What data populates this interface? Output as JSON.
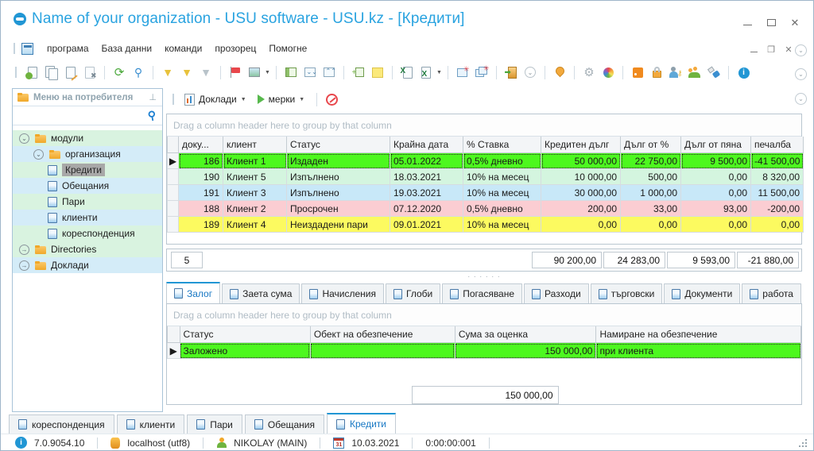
{
  "window": {
    "title": "Name of your organization - USU software - USU.kz - [Кредити]",
    "logo_icon": "usu-logo-icon",
    "minimize_label": "−",
    "maximize_label": "□",
    "close_label": "✕",
    "mdi_minimize_label": "−",
    "mdi_restore_label": "❐",
    "mdi_close_label": "✕"
  },
  "menubar": {
    "app_icon": "application-icon",
    "items": [
      {
        "label": "програма",
        "name": "menu-programa"
      },
      {
        "label": "База данни",
        "name": "menu-baza-danni"
      },
      {
        "label": "команди",
        "name": "menu-komandi"
      },
      {
        "label": "прозорец",
        "name": "menu-prozorec"
      },
      {
        "label": "Помогне",
        "name": "menu-pomogne"
      }
    ]
  },
  "toolbar": {
    "buttons": [
      {
        "name": "add-record-button",
        "icon": "document-add-icon"
      },
      {
        "name": "copy-record-button",
        "icon": "document-copy-icon"
      },
      {
        "name": "edit-record-button",
        "icon": "document-edit-icon"
      },
      {
        "name": "delete-record-button",
        "icon": "document-delete-icon"
      },
      {
        "name": "refresh-button",
        "icon": "refresh-icon"
      },
      {
        "name": "search-button",
        "icon": "magnifier-icon"
      },
      {
        "name": "filter-button",
        "icon": "funnel-icon"
      },
      {
        "name": "filter-builder-button",
        "icon": "funnel-award-icon"
      },
      {
        "name": "apply-filter-button",
        "icon": "funnel-check-icon"
      },
      {
        "name": "flag-button",
        "icon": "red-flag-icon"
      },
      {
        "name": "image-button",
        "icon": "picture-icon"
      },
      {
        "name": "expand-group-button",
        "icon": "grid-expand-icon"
      },
      {
        "name": "expand-all-button",
        "icon": "chevron-double-down-icon"
      },
      {
        "name": "collapse-all-button",
        "icon": "chevron-double-up-icon"
      },
      {
        "name": "add-column-button",
        "icon": "column-add-icon"
      },
      {
        "name": "note-button",
        "icon": "sticky-note-icon"
      },
      {
        "name": "export-excel-button",
        "icon": "excel-export-icon"
      },
      {
        "name": "export-excel2-button",
        "icon": "excel-export-alt-icon"
      },
      {
        "name": "new-window-button",
        "icon": "window-new-icon"
      },
      {
        "name": "close-windows-button",
        "icon": "windows-close-icon"
      },
      {
        "name": "exit-button",
        "icon": "exit-door-icon"
      },
      {
        "name": "map-button",
        "icon": "map-pin-icon"
      },
      {
        "name": "settings-button",
        "icon": "gear-icon"
      },
      {
        "name": "theme-button",
        "icon": "color-wheel-icon"
      },
      {
        "name": "rss-button",
        "icon": "rss-icon"
      },
      {
        "name": "lock-button",
        "icon": "lock-icon"
      },
      {
        "name": "user-rights-button",
        "icon": "user-key-icon"
      },
      {
        "name": "users-button",
        "icon": "users-group-icon"
      },
      {
        "name": "plugin-button",
        "icon": "plug-icon"
      },
      {
        "name": "about-button",
        "icon": "info-icon"
      }
    ]
  },
  "sidebar": {
    "title": "Меню на потребителя",
    "folder_icon": "folder-icon",
    "pin_icon": "pin-icon",
    "search_icon": "search-icon",
    "search_value": "",
    "tree": [
      {
        "label": "модули",
        "type": "folder",
        "expander": "collapse-icon",
        "indent": 0,
        "stripe": "green"
      },
      {
        "label": "организация",
        "type": "folder",
        "expander": "collapse-icon",
        "indent": 1,
        "stripe": "blue"
      },
      {
        "label": "Кредити",
        "type": "module",
        "indent": 2,
        "stripe": "green",
        "selected": true
      },
      {
        "label": "Обещания",
        "type": "module",
        "indent": 2,
        "stripe": "blue"
      },
      {
        "label": "Пари",
        "type": "module",
        "indent": 2,
        "stripe": "green"
      },
      {
        "label": "клиенти",
        "type": "module",
        "indent": 2,
        "stripe": "blue"
      },
      {
        "label": "кореспонденция",
        "type": "module",
        "indent": 2,
        "stripe": "green"
      },
      {
        "label": "Directories",
        "type": "folder",
        "expander": "expand-icon",
        "indent": 0,
        "stripe": "green"
      },
      {
        "label": "Доклади",
        "type": "folder",
        "expander": "expand-icon",
        "indent": 0,
        "stripe": "blue"
      }
    ]
  },
  "content_toolbar": {
    "reports_label": "Доклади",
    "reports_icon": "report-chart-icon",
    "measures_label": "мерки",
    "measures_icon": "play-triangle-icon",
    "stop_icon": "stop-icon",
    "caret": "▾"
  },
  "main_grid": {
    "group_hint": "Drag a column header here to group by that column",
    "columns": [
      "доку...",
      "клиент",
      "Статус",
      "Крайна дата",
      "% Ставка",
      "Кредитен дълг",
      "Дълг от %",
      "Дълг от пяна",
      "печалба"
    ],
    "rows": [
      {
        "selected": true,
        "color": "green",
        "cells": [
          "186",
          "Клиент 1",
          "Издаден",
          "05.01.2022",
          "0,5% дневно",
          "50 000,00",
          "22 750,00",
          "9 500,00",
          "-41 500,00"
        ]
      },
      {
        "selected": false,
        "color": "mint",
        "cells": [
          "190",
          "Клиент 5",
          "Изпълнено",
          "18.03.2021",
          "10% на месец",
          "10 000,00",
          "500,00",
          "0,00",
          "8 320,00"
        ]
      },
      {
        "selected": false,
        "color": "blue",
        "cells": [
          "191",
          "Клиент 3",
          "Изпълнено",
          "19.03.2021",
          "10% на месец",
          "30 000,00",
          "1 000,00",
          "0,00",
          "11 500,00"
        ]
      },
      {
        "selected": false,
        "color": "pink",
        "cells": [
          "188",
          "Клиент 2",
          "Просрочен",
          "07.12.2020",
          "0,5% дневно",
          "200,00",
          "33,00",
          "93,00",
          "-200,00"
        ]
      },
      {
        "selected": false,
        "color": "yellow",
        "cells": [
          "189",
          "Клиент 4",
          "Неиздадени пари",
          "09.01.2021",
          "10% на месец",
          "0,00",
          "0,00",
          "0,00",
          "0,00"
        ]
      }
    ],
    "summary": {
      "count": "5",
      "credit_debt": "90 200,00",
      "percent_debt": "24 283,00",
      "penalty_debt": "9 593,00",
      "profit": "-21 880,00"
    }
  },
  "detail_tabs": {
    "tab_icon": "module-icon",
    "items": [
      {
        "label": "Залог",
        "active": true
      },
      {
        "label": "Заета сума",
        "active": false
      },
      {
        "label": "Начисления",
        "active": false
      },
      {
        "label": "Глоби",
        "active": false
      },
      {
        "label": "Погасяване",
        "active": false
      },
      {
        "label": "Разходи",
        "active": false
      },
      {
        "label": "търговски",
        "active": false
      },
      {
        "label": "Документи",
        "active": false
      },
      {
        "label": "работа",
        "active": false
      }
    ]
  },
  "detail_grid": {
    "group_hint": "Drag a column header here to group by that column",
    "columns": [
      "Статус",
      "Обект на обезпечение",
      "Сума за оценка",
      "Намиране на обезпечение"
    ],
    "rows": [
      {
        "selected": true,
        "color": "green",
        "cells": [
          "Заложено",
          "",
          "150 000,00",
          "при клиента"
        ]
      }
    ],
    "summary": {
      "total": "150 000,00"
    }
  },
  "bottom_tabs": {
    "tab_icon": "module-icon",
    "items": [
      {
        "label": "кореспонденция",
        "active": false
      },
      {
        "label": "клиенти",
        "active": false
      },
      {
        "label": "Пари",
        "active": false
      },
      {
        "label": "Обещания",
        "active": false
      },
      {
        "label": "Кредити",
        "active": true
      }
    ]
  },
  "statusbar": {
    "version": "7.0.9054.10",
    "version_icon": "info-icon",
    "server": "localhost (utf8)",
    "server_icon": "database-icon",
    "user": "NIKOLAY (MAIN)",
    "user_icon": "user-icon",
    "date": "10.03.2021",
    "date_icon": "calendar-icon",
    "elapsed": "0:00:00:001"
  },
  "colors": {
    "accent": "#2196d4",
    "title_text": "#29a3e0",
    "row_green": "#4df81f",
    "row_mint": "#d4f5df",
    "row_blue": "#c8e8f8",
    "row_pink": "#fbcdd2",
    "row_yellow": "#fcfa60",
    "tree_green": "#d9f3e0",
    "tree_blue": "#d4ecf8"
  }
}
